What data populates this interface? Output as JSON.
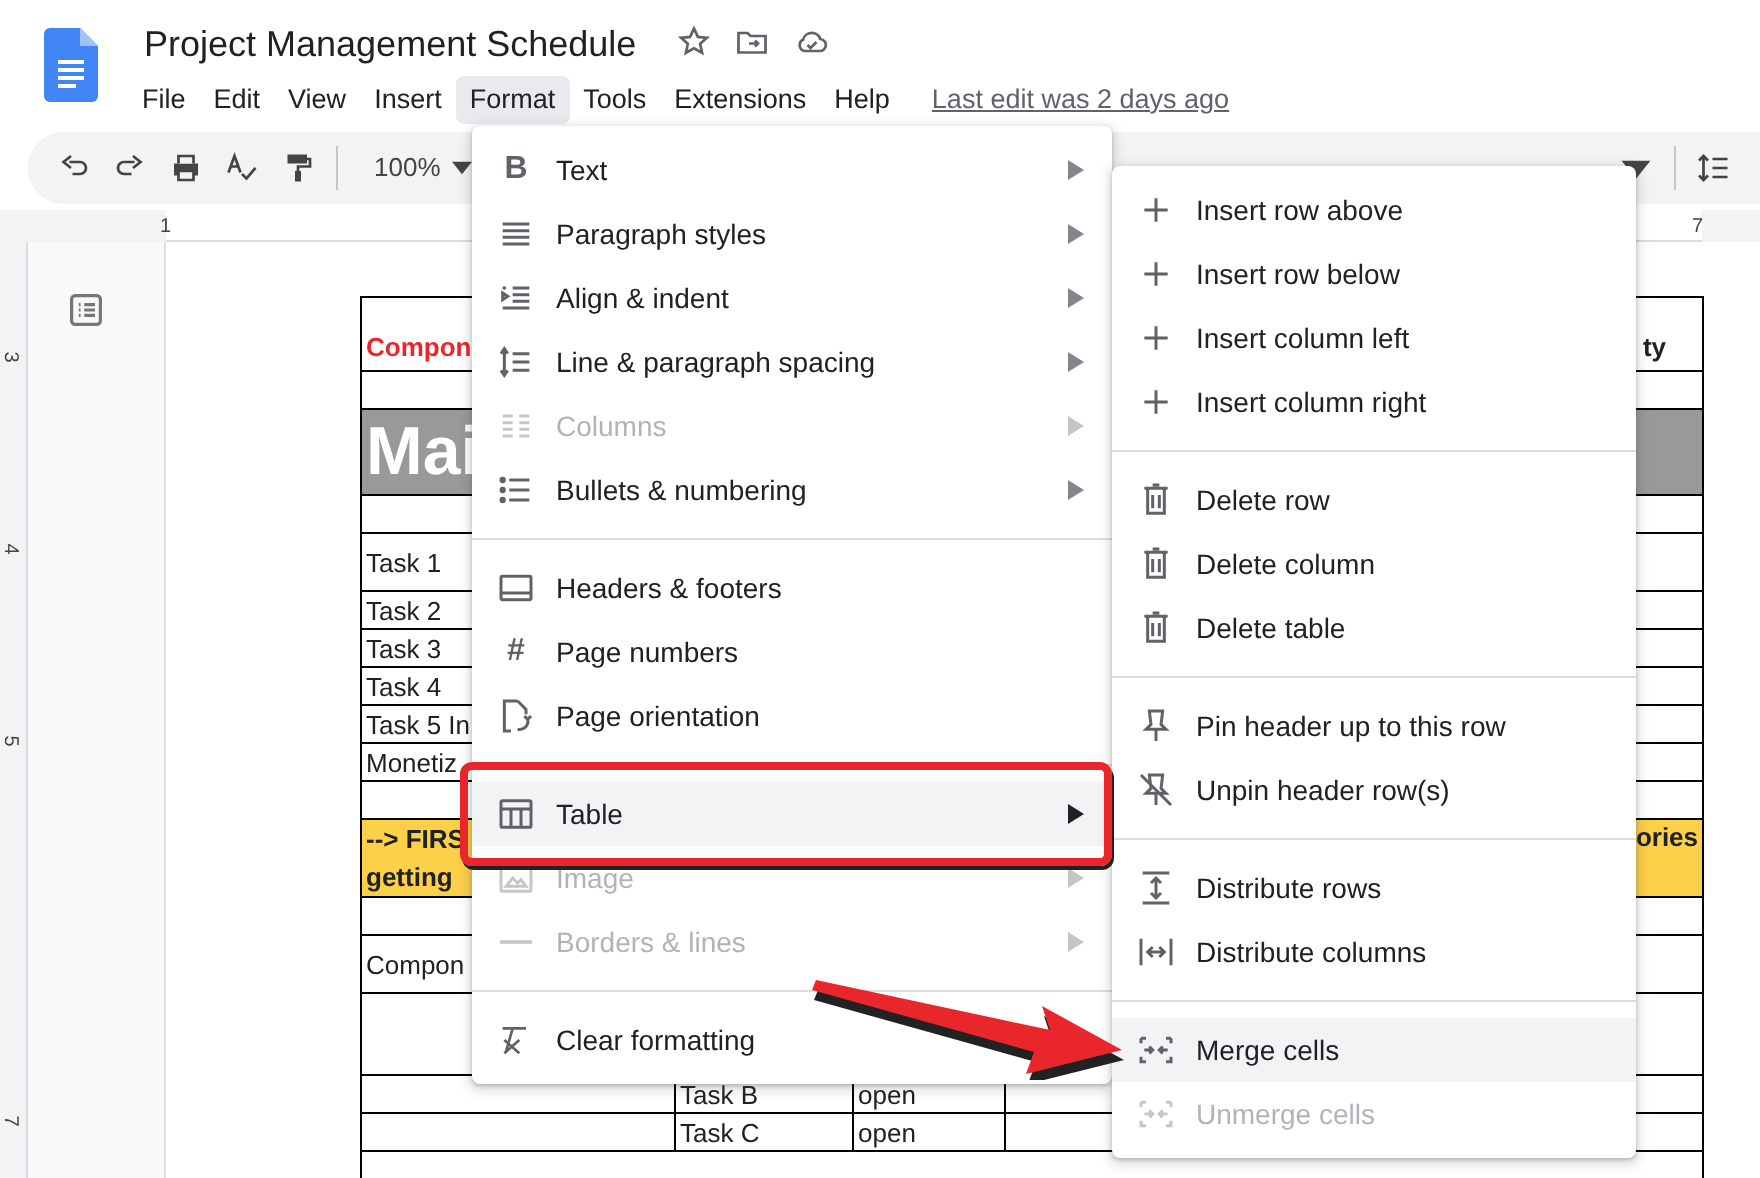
{
  "app": {
    "title": "Project Management Schedule",
    "last_edit": "Last edit was 2 days ago"
  },
  "menu_bar": [
    {
      "label": "File",
      "selected": false
    },
    {
      "label": "Edit",
      "selected": false
    },
    {
      "label": "View",
      "selected": false
    },
    {
      "label": "Insert",
      "selected": false
    },
    {
      "label": "Format",
      "selected": true
    },
    {
      "label": "Tools",
      "selected": false
    },
    {
      "label": "Extensions",
      "selected": false
    },
    {
      "label": "Help",
      "selected": false
    }
  ],
  "toolbar": {
    "zoom": "100%"
  },
  "ruler": {
    "top_labels": [
      "1",
      "7"
    ],
    "side_labels": [
      "3",
      "4",
      "5",
      "7"
    ]
  },
  "document_table": {
    "rows": [
      {
        "kind": "header",
        "first": "Compon",
        "last": "ty"
      },
      {
        "kind": "blank"
      },
      {
        "kind": "banner",
        "first": "Mai"
      },
      {
        "kind": "blank"
      },
      {
        "kind": "tall",
        "first": "Task 1"
      },
      {
        "kind": "task",
        "first": "Task 2"
      },
      {
        "kind": "task",
        "first": "Task 3"
      },
      {
        "kind": "task",
        "first": "Task 4"
      },
      {
        "kind": "task",
        "first": "Task 5 In"
      },
      {
        "kind": "task",
        "first": "Monetiz"
      },
      {
        "kind": "blank"
      },
      {
        "kind": "callout",
        "first_lines": [
          "--> FIRS",
          "getting"
        ],
        "last": "ories"
      },
      {
        "kind": "blank"
      },
      {
        "kind": "tall",
        "first": "Compon"
      },
      {
        "kind": "spacer"
      },
      {
        "kind": "subtask",
        "second": "Task B",
        "third": "open"
      },
      {
        "kind": "subtask",
        "second": "Task C",
        "third": "open"
      },
      {
        "kind": "blank"
      }
    ]
  },
  "format_menu": {
    "groups": [
      [
        {
          "label": "Text",
          "icon_text": "B",
          "submenu": true,
          "disabled": false,
          "selected": false
        },
        {
          "label": "Paragraph styles",
          "submenu": true,
          "disabled": false,
          "selected": false
        },
        {
          "label": "Align & indent",
          "submenu": true,
          "disabled": false,
          "selected": false
        },
        {
          "label": "Line & paragraph spacing",
          "submenu": true,
          "disabled": false,
          "selected": false
        },
        {
          "label": "Columns",
          "submenu": true,
          "disabled": true,
          "selected": false
        },
        {
          "label": "Bullets & numbering",
          "submenu": true,
          "disabled": false,
          "selected": false
        }
      ],
      [
        {
          "label": "Headers & footers",
          "submenu": false,
          "disabled": false,
          "selected": false
        },
        {
          "label": "Page numbers",
          "icon_text": "#",
          "submenu": false,
          "disabled": false,
          "selected": false
        },
        {
          "label": "Page orientation",
          "submenu": false,
          "disabled": false,
          "selected": false
        }
      ],
      [
        {
          "label": "Table",
          "submenu": true,
          "disabled": false,
          "selected": true
        },
        {
          "label": "Image",
          "submenu": true,
          "disabled": true,
          "selected": false
        },
        {
          "label": "Borders & lines",
          "submenu": true,
          "disabled": true,
          "selected": false
        }
      ],
      [
        {
          "label": "Clear formatting",
          "disabled": false,
          "selected": false
        }
      ]
    ]
  },
  "table_submenu": {
    "groups": [
      [
        {
          "label": "Insert row above",
          "disabled": false,
          "selected": false
        },
        {
          "label": "Insert row below",
          "disabled": false,
          "selected": false
        },
        {
          "label": "Insert column left",
          "disabled": false,
          "selected": false
        },
        {
          "label": "Insert column right",
          "disabled": false,
          "selected": false
        }
      ],
      [
        {
          "label": "Delete row",
          "disabled": false,
          "selected": false
        },
        {
          "label": "Delete column",
          "disabled": false,
          "selected": false
        },
        {
          "label": "Delete table",
          "disabled": false,
          "selected": false
        }
      ],
      [
        {
          "label": "Pin header up to this row",
          "disabled": false,
          "selected": false
        },
        {
          "label": "Unpin header row(s)",
          "disabled": false,
          "selected": false
        }
      ],
      [
        {
          "label": "Distribute rows",
          "disabled": false,
          "selected": false
        },
        {
          "label": "Distribute columns",
          "disabled": false,
          "selected": false
        }
      ],
      [
        {
          "label": "Merge cells",
          "disabled": false,
          "selected": true
        },
        {
          "label": "Unmerge cells",
          "disabled": true,
          "selected": false
        }
      ]
    ]
  }
}
